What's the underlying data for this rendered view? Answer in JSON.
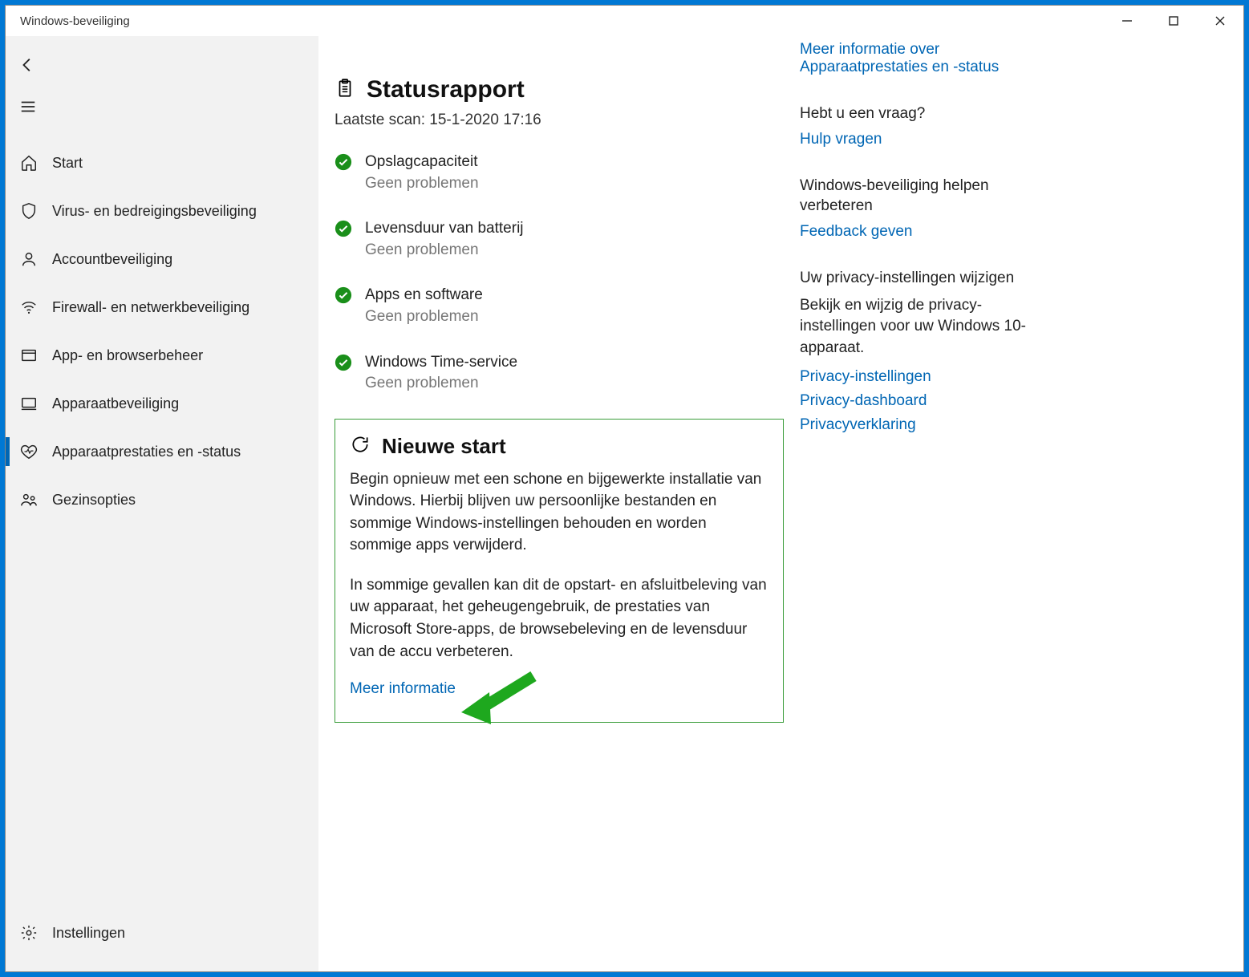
{
  "window": {
    "title": "Windows-beveiliging"
  },
  "sidebar": {
    "items": [
      {
        "icon": "home-icon",
        "label": "Start"
      },
      {
        "icon": "shield-icon",
        "label": "Virus- en bedreigingsbeveiliging"
      },
      {
        "icon": "person-icon",
        "label": "Accountbeveiliging"
      },
      {
        "icon": "wifi-icon",
        "label": "Firewall- en netwerkbeveiliging"
      },
      {
        "icon": "browser-icon",
        "label": "App- en browserbeheer"
      },
      {
        "icon": "device-icon",
        "label": "Apparaatbeveiliging"
      },
      {
        "icon": "heart-icon",
        "label": "Apparaatprestaties en -status"
      },
      {
        "icon": "family-icon",
        "label": "Gezinsopties"
      }
    ],
    "settings_label": "Instellingen"
  },
  "main": {
    "report": {
      "title": "Statusrapport",
      "last_scan": "Laatste scan: 15-1-2020 17:16",
      "items": [
        {
          "label": "Opslagcapaciteit",
          "sub": "Geen problemen"
        },
        {
          "label": "Levensduur van batterij",
          "sub": "Geen problemen"
        },
        {
          "label": "Apps en software",
          "sub": "Geen problemen"
        },
        {
          "label": "Windows Time-service",
          "sub": "Geen problemen"
        }
      ]
    },
    "fresh_start": {
      "title": "Nieuwe start",
      "p1": "Begin opnieuw met een schone en bijgewerkte installatie van Windows. Hierbij blijven uw persoonlijke bestanden en sommige Windows-instellingen behouden en worden sommige apps verwijderd.",
      "p2": "In sommige gevallen kan dit de opstart- en afsluitbeleving van uw apparaat, het geheugengebruik, de prestaties van Microsoft Store-apps, de browsebeleving en de levensduur van de accu verbeteren.",
      "link": "Meer informatie"
    }
  },
  "aside": {
    "more_info_link": "Meer informatie over Apparaatprestaties en -status",
    "question": {
      "title": "Hebt u een vraag?",
      "link": "Hulp vragen"
    },
    "improve": {
      "title": "Windows-beveiliging helpen verbeteren",
      "link": "Feedback geven"
    },
    "privacy": {
      "title": "Uw privacy-instellingen wijzigen",
      "body": "Bekijk en wijzig de privacy-instellingen voor uw Windows 10-apparaat.",
      "links": [
        "Privacy-instellingen",
        "Privacy-dashboard",
        "Privacyverklaring"
      ]
    }
  },
  "colors": {
    "accent": "#0066b4",
    "green_box": "#3a9d3a",
    "check_green": "#1a8f1a"
  }
}
